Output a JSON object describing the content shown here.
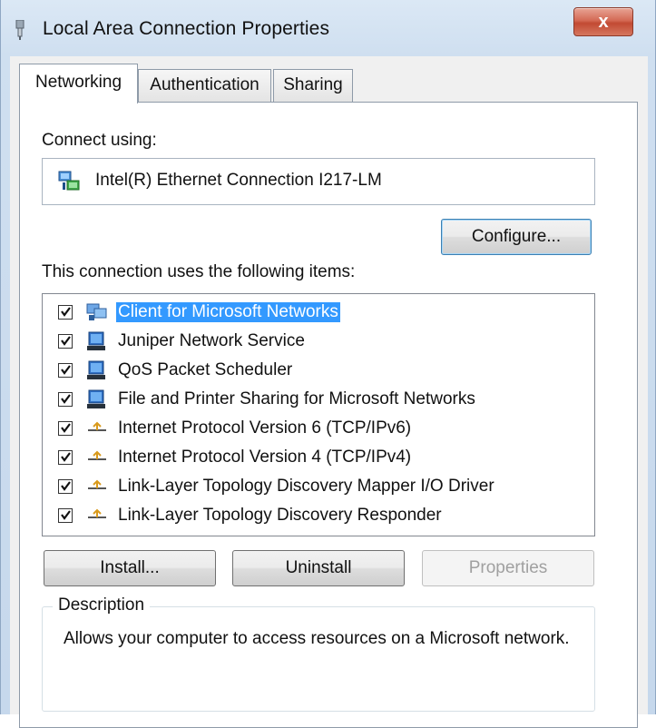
{
  "window": {
    "title": "Local Area Connection Properties",
    "close_label": "x"
  },
  "tabs": [
    {
      "label": "Networking",
      "active": true
    },
    {
      "label": "Authentication",
      "active": false
    },
    {
      "label": "Sharing",
      "active": false
    }
  ],
  "connect_using": {
    "label": "Connect using:",
    "adapter_name": "Intel(R) Ethernet Connection I217-LM",
    "adapter_icon": "network-adapter-icon"
  },
  "configure_label": "Configure...",
  "items_label": "This connection uses the following items:",
  "items": [
    {
      "label": "Client for Microsoft Networks",
      "checked": true,
      "selected": true,
      "icon": "network-client-icon"
    },
    {
      "label": "Juniper Network Service",
      "checked": true,
      "selected": false,
      "icon": "network-service-icon"
    },
    {
      "label": "QoS Packet Scheduler",
      "checked": true,
      "selected": false,
      "icon": "network-service-icon"
    },
    {
      "label": "File and Printer Sharing for Microsoft Networks",
      "checked": true,
      "selected": false,
      "icon": "network-service-icon"
    },
    {
      "label": "Internet Protocol Version 6 (TCP/IPv6)",
      "checked": true,
      "selected": false,
      "icon": "protocol-icon"
    },
    {
      "label": "Internet Protocol Version 4 (TCP/IPv4)",
      "checked": true,
      "selected": false,
      "icon": "protocol-icon"
    },
    {
      "label": "Link-Layer Topology Discovery Mapper I/O Driver",
      "checked": true,
      "selected": false,
      "icon": "protocol-icon"
    },
    {
      "label": "Link-Layer Topology Discovery Responder",
      "checked": true,
      "selected": false,
      "icon": "protocol-icon"
    }
  ],
  "buttons": {
    "install": "Install...",
    "uninstall": "Uninstall",
    "properties": "Properties"
  },
  "description": {
    "legend": "Description",
    "text": "Allows your computer to access resources on a Microsoft network."
  },
  "colors": {
    "selection": "#3399ff",
    "close_button": "#c24a33",
    "title_bar": "#cfdff0"
  }
}
